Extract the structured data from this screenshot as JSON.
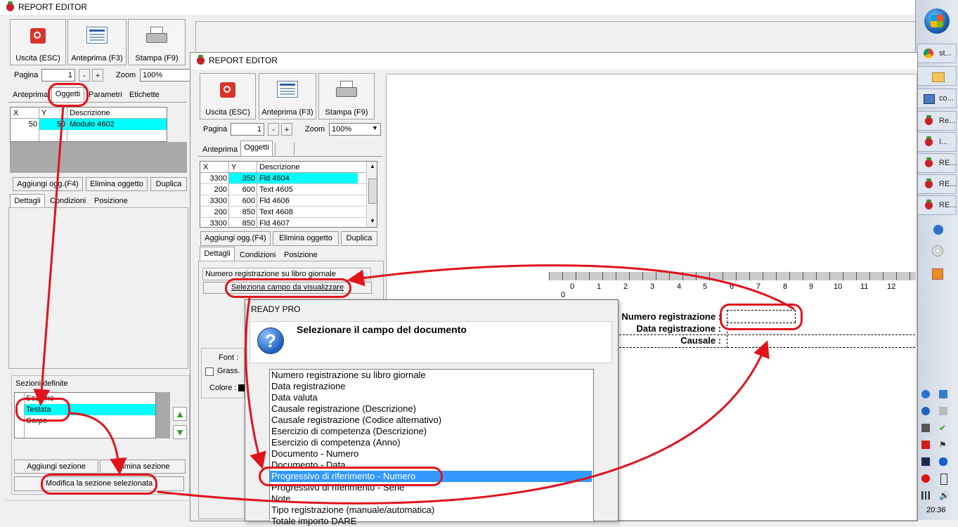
{
  "app": {
    "title": "REPORT EDITOR"
  },
  "toolbar": {
    "exit": "Uscita (ESC)",
    "preview": "Anteprima (F3)",
    "print": "Stampa (F9)"
  },
  "pager": {
    "page_label": "Pagina",
    "page_value": "1",
    "minus": "-",
    "plus": "+",
    "zoom_label": "Zoom",
    "zoom_value": "100%"
  },
  "back": {
    "tabs": [
      "Anteprima",
      "Oggetti",
      "Parametri",
      "Etichette"
    ],
    "grid": {
      "headers": [
        "X",
        "Y",
        "Descrizione"
      ],
      "row": {
        "x": "50",
        "y": "50",
        "desc": "Modulo 4602"
      }
    },
    "buttons": {
      "add": "Aggiungi ogg.(F4)",
      "delete": "Elimina oggetto",
      "dup": "Duplica"
    },
    "subtabs": [
      "Dettagli",
      "Condizioni",
      "Posizione"
    ],
    "sections": {
      "label": "Sezioni definite",
      "header": "Sezione",
      "items": [
        "Testata",
        "Corpo"
      ],
      "add": "Aggiungi sezione",
      "delete": "Elimina sezione",
      "modify": "Modifica la sezione selezionata"
    }
  },
  "front": {
    "tabs": [
      "Anteprima",
      "Oggetti"
    ],
    "grid": {
      "headers": [
        "X",
        "Y",
        "Descrizione"
      ],
      "rows": [
        {
          "x": "3300",
          "y": "350",
          "desc": "Fld 4604"
        },
        {
          "x": "200",
          "y": "600",
          "desc": "Text 4605"
        },
        {
          "x": "3300",
          "y": "600",
          "desc": "Fld 4606"
        },
        {
          "x": "200",
          "y": "850",
          "desc": "Text 4608"
        },
        {
          "x": "3300",
          "y": "850",
          "desc": "Fld 4607"
        }
      ]
    },
    "buttons": {
      "add": "Aggiungi ogg.(F4)",
      "delete": "Elimina oggetto",
      "dup": "Duplica"
    },
    "subtabs": [
      "Dettagli",
      "Condizioni",
      "Posizione"
    ],
    "field_value": "Numero registrazione su libro giornale",
    "select_field_btn": "Seleziona campo da visualizzare",
    "font_label": "Font :",
    "bold_label": "Grass.",
    "color_label": "Colore :"
  },
  "ruler": {
    "zero": "0",
    "ticks": [
      "0",
      "1",
      "2",
      "3",
      "4",
      "5",
      "6",
      "7",
      "8",
      "9",
      "10",
      "11",
      "12"
    ]
  },
  "canvas": {
    "labels": [
      "Numero registrazione :",
      "Data registrazione :",
      "Causale :"
    ]
  },
  "dialog": {
    "title": "READY PRO",
    "heading": "Selezionare il campo del documento",
    "items": [
      "Numero registrazione su libro giornale",
      "Data registrazione",
      "Data valuta",
      "Causale registrazione (Descrizione)",
      "Causale registrazione (Codice alternativo)",
      "Esercizio di competenza (Descrizione)",
      "Esercizio di competenza (Anno)",
      "Documento - Numero",
      "Documento - Data",
      "Progressivo di riferimento - Numero",
      "Progressivo di riferimento - Serie",
      "Note",
      "Tipo registrazione (manuale/automatica)",
      "Totale importo DARE"
    ],
    "selected_index": 9
  },
  "taskbar": {
    "buttons": [
      "st...",
      "",
      "co...",
      "Re...",
      "I...",
      "RE...",
      "RE...",
      "RE..."
    ],
    "time": "20:36"
  },
  "colors": {
    "selection": "#00ffff",
    "list_selection": "#3399ff",
    "annotation": "#e1131b"
  }
}
